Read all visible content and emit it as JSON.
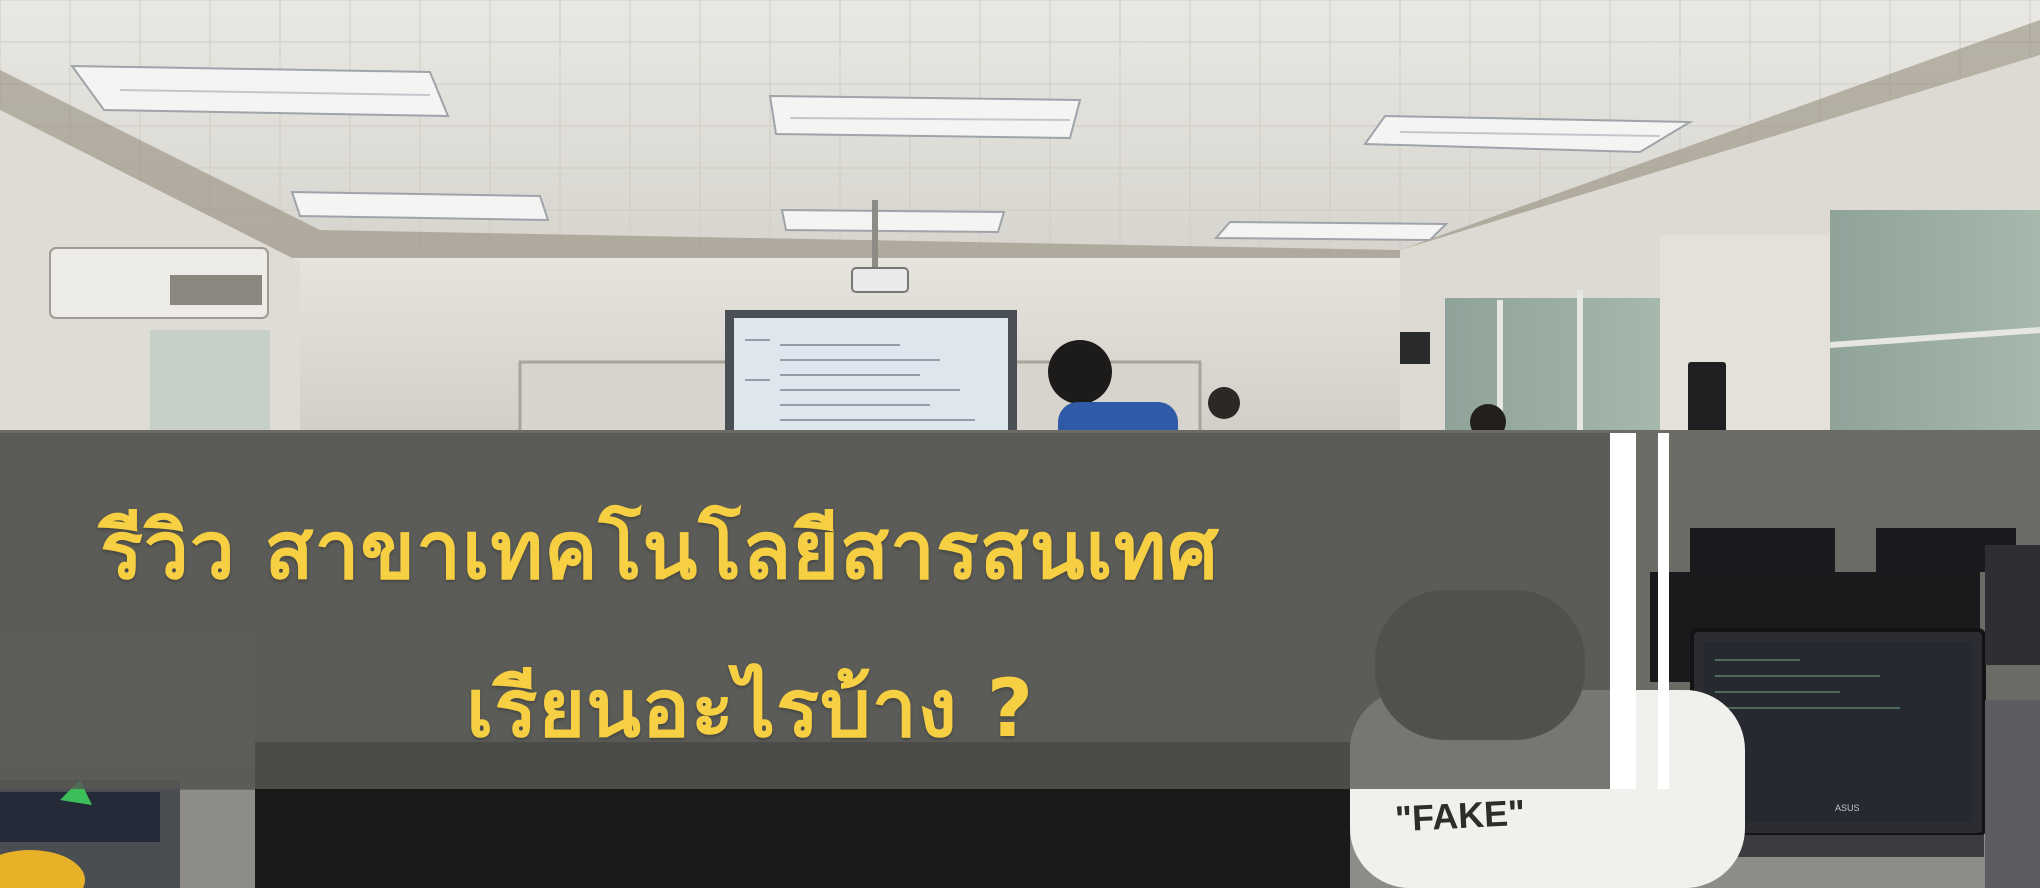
{
  "photo": {
    "description_text": "",
    "shirt_text": "\"FAKE\"",
    "laptop_brand": "ASUS"
  },
  "overlay": {
    "title_line1": "รีวิว สาขาเทคโนโลยีสารสนเทศ",
    "title_line2": "เรียนอะไรบ้าง ?",
    "text_color": "#f7cf43",
    "banner_color": "#585854"
  }
}
